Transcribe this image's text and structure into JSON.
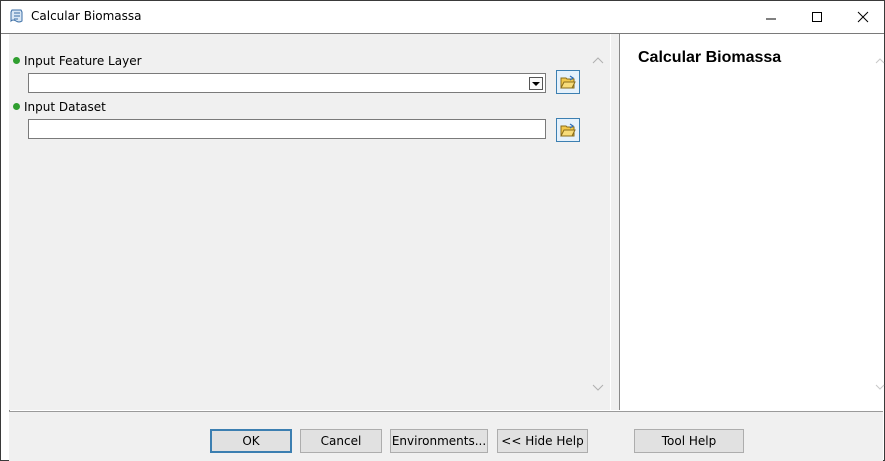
{
  "window": {
    "title": "Calcular Biomassa",
    "app_icon": "toolbox-script-icon",
    "controls": [
      "minimize-icon",
      "maximize-icon",
      "close-icon"
    ]
  },
  "form": {
    "params": [
      {
        "label": "Input Feature Layer",
        "value": "",
        "type": "dropdown"
      },
      {
        "label": "Input Dataset",
        "value": "",
        "type": "text"
      }
    ]
  },
  "help": {
    "title": "Calcular Biomassa"
  },
  "buttons": {
    "ok": "OK",
    "cancel": "Cancel",
    "environments": "Environments...",
    "hide_help": "<< Hide Help",
    "tool_help": "Tool Help"
  },
  "colors": {
    "required_dot": "#2f9e2f",
    "accent": "#3c7fb1"
  }
}
